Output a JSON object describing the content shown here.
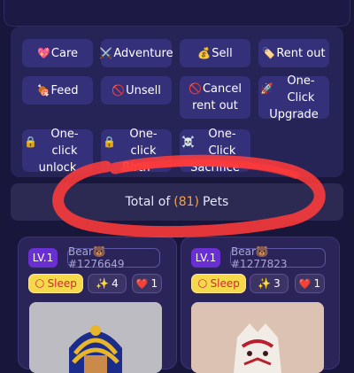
{
  "actions": {
    "care": {
      "icon": "💖",
      "label": "Care"
    },
    "adventure": {
      "icon": "⚔️",
      "label": "Adventure"
    },
    "sell": {
      "icon": "💰",
      "label": "Sell"
    },
    "rent_out": {
      "icon": "🏷️",
      "label": "Rent out"
    },
    "feed": {
      "icon": "🍖",
      "label": "Feed"
    },
    "unsell": {
      "icon": "🚫",
      "label": "Unsell"
    },
    "cancel_rent": {
      "icon": "🚫",
      "label_line1": "Cancel",
      "label_line2": "rent out"
    },
    "one_click_upgrade": {
      "icon": "🚀",
      "label_line1": "One-Click",
      "label_line2": "Upgrade"
    },
    "one_click_unlock": {
      "icon": "🔒",
      "label_line1": "One-click",
      "label_line2": "unlock"
    },
    "one_click_birth": {
      "icon": "🔒",
      "label_line1": "One-click",
      "label_line2": "Birth"
    },
    "one_click_sacrifice": {
      "icon": "☠️",
      "label_line1": "One-Click",
      "label_line2": "Sacrifice"
    }
  },
  "summary": {
    "prefix": "Total of",
    "count": "(81)",
    "suffix": "Pets"
  },
  "pets": [
    {
      "level": "LV.1",
      "name": "Bear🐻#1276649",
      "status_icon": "🌕",
      "status": "Sleep",
      "stars_icon": "✨",
      "stars": "4",
      "likes_icon": "❤️",
      "likes": "1"
    },
    {
      "level": "LV.1",
      "name": "Bear🐻#1277823",
      "status_icon": "🌕",
      "status": "Sleep",
      "stars_icon": "✨",
      "stars": "3",
      "likes_icon": "❤️",
      "likes": "1"
    }
  ],
  "colors": {
    "accent": "#f4a14a",
    "level_badge": "#6a2fd2",
    "sleep_badge": "#f6d94b",
    "annotation": "#ff3b3b"
  }
}
